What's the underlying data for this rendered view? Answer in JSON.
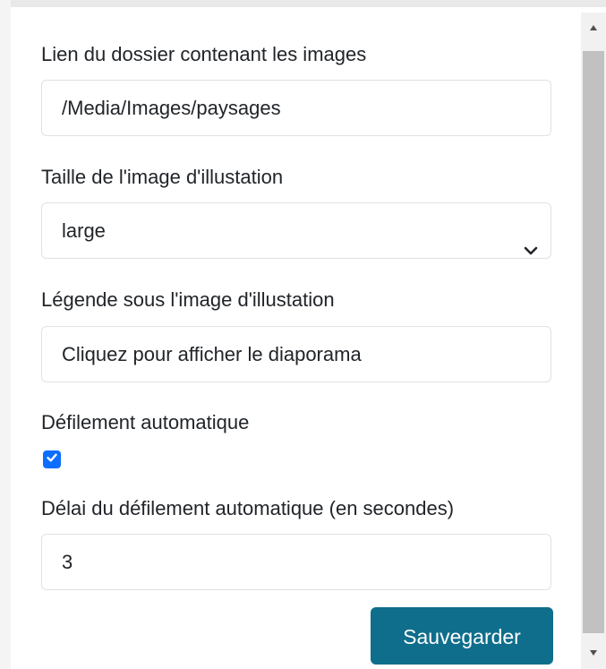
{
  "form": {
    "folder_label": "Lien du dossier contenant les images",
    "folder_value": "/Media/Images/paysages",
    "size_label": "Taille de l'image d'illustation",
    "size_value": "large",
    "caption_label": "Légende sous l'image d'illustation",
    "caption_value": "Cliquez pour afficher le diaporama",
    "autoscroll_label": "Défilement automatique",
    "autoscroll_checked": true,
    "delay_label": "Délai du défilement automatique (en secondes)",
    "delay_value": "3",
    "save_label": "Sauvegarder"
  },
  "colors": {
    "accent": "#0d6efd",
    "button": "#0f6e8c"
  },
  "icons": {
    "select_arrow": "chevron-down-icon",
    "checkbox_mark": "check-icon",
    "scroll_up": "triangle-up-icon",
    "scroll_down": "triangle-down-icon"
  }
}
